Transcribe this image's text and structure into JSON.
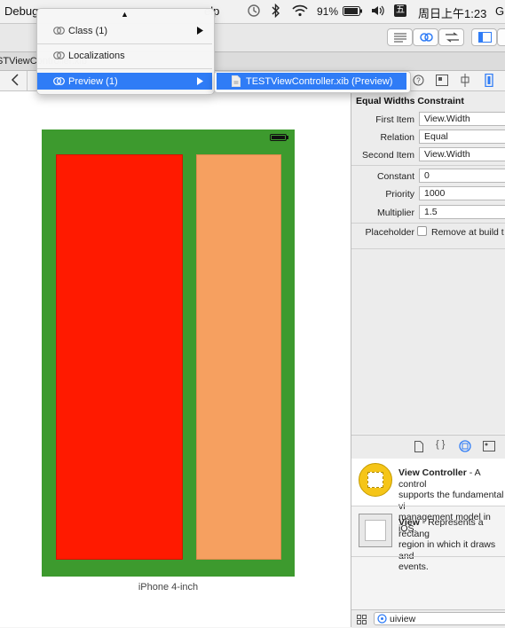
{
  "menubar": {
    "debug": "Debug",
    "help": "Help",
    "battery": "91%",
    "ime": "五",
    "clock": "周日上午1:23",
    "overflow": "G"
  },
  "tab": {
    "title": "TESTViewController.xib"
  },
  "menu": {
    "items": [
      {
        "label": "Class (1)",
        "has_submenu": true
      },
      {
        "label": "Localizations",
        "has_submenu": false
      },
      {
        "label": "Preview (1)",
        "has_submenu": true,
        "highlighted": true
      }
    ],
    "submenu_item": "TESTViewController.xib (Preview)"
  },
  "canvas": {
    "device_label": "iPhone 4-inch",
    "phone_color": "#3d9a2e",
    "left_view_color": "#ff1a00",
    "right_view_color": "#f6a060"
  },
  "inspector": {
    "section_title": "Equal Widths Constraint",
    "first_item_label": "First Item",
    "first_item_value": "View.Width",
    "relation_label": "Relation",
    "relation_value": "Equal",
    "second_item_label": "Second Item",
    "second_item_value": "View.Width",
    "constant_label": "Constant",
    "constant_value": "0",
    "priority_label": "Priority",
    "priority_value": "1000",
    "multiplier_label": "Multiplier",
    "multiplier_value": "1.5",
    "placeholder_label": "Placeholder",
    "placeholder_checkbox_label": "Remove at build t"
  },
  "library": {
    "items": [
      {
        "title": "View Controller",
        "desc_1": " - A control",
        "desc_2": "supports the fundamental vi",
        "desc_3": "management model in iOS."
      },
      {
        "title": "View",
        "desc_1": " - Represents a rectang",
        "desc_2": "region in which it draws and",
        "desc_3": "events."
      }
    ],
    "filter_value": "uiview"
  },
  "colors": {
    "accent": "#2f7cf6"
  }
}
